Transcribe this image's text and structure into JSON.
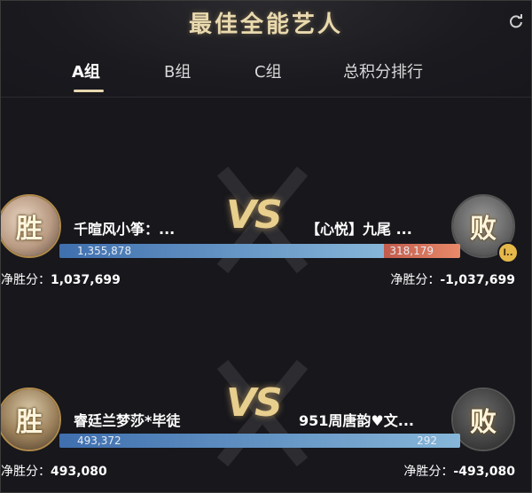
{
  "header": {
    "title": "最佳全能艺人",
    "refresh_icon": "refresh-icon"
  },
  "tabs": [
    {
      "label": "A组",
      "active": true
    },
    {
      "label": "B组",
      "active": false
    },
    {
      "label": "C组",
      "active": false
    },
    {
      "label": "总积分排行",
      "active": false
    }
  ],
  "vs_label": "VS",
  "matches": [
    {
      "left": {
        "name": "千暄风小筝：...",
        "result": "胜",
        "score": "1,355,878",
        "net_label": "净胜分：",
        "net_value": "1,037,699"
      },
      "right": {
        "name": "【心悦】九尾 ...",
        "result": "败",
        "score": "318,179",
        "net_label": "净胜分：",
        "net_value": "-1,037,699"
      },
      "share_left": 0.81
    },
    {
      "left": {
        "name": "睿廷兰梦莎*毕徒",
        "result": "胜",
        "score": "493,372",
        "net_label": "净胜分：",
        "net_value": "493,080"
      },
      "right": {
        "name": "951周唐韵♥文...",
        "result": "败",
        "score": "292",
        "net_label": "净胜分：",
        "net_value": "-493,080"
      },
      "share_left": 1.0
    }
  ],
  "colors": {
    "background": "#17171c",
    "gold": "#e8cf8e",
    "bar_blue": "#86b6d8",
    "bar_red": "#e88a6a"
  }
}
